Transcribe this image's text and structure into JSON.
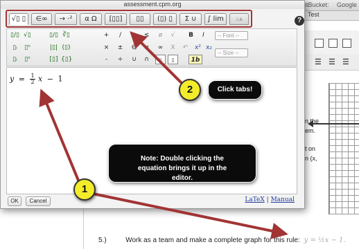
{
  "window": {
    "title": "assessment.cpm.org",
    "browser_tab_1": "itBucket:",
    "browser_tab_2": "Google",
    "doc_tab": "Test"
  },
  "editor": {
    "tabs": [
      {
        "label": "√▯ ▯",
        "icon": "roots-fractions-icon"
      },
      {
        "label": "∈∞",
        "icon": "set-infinity-icon"
      },
      {
        "label": "→ ⋅²",
        "icon": "arrows-exponent-icon"
      },
      {
        "label": "α Ω",
        "icon": "greek-letters-icon"
      },
      {
        "label": "[▯▯]",
        "icon": "matrix-icon"
      },
      {
        "label": "▯▯",
        "icon": "subscript-superscript-icon"
      },
      {
        "label": "(▯) ▯",
        "icon": "brackets-icon"
      },
      {
        "label": "Σ ∪",
        "icon": "sum-union-icon"
      },
      {
        "label": "∫ lim",
        "icon": "integral-limit-icon"
      },
      {
        "label": "▵▴",
        "icon": "extra-symbols-icon"
      }
    ],
    "help_label": "?",
    "toolbar": {
      "row1": [
        "▯/▯",
        "√▯",
        "▯/▯",
        "∛▯",
        "+",
        "/",
        "≥",
        "≤",
        "ø",
        "√",
        "B",
        "I"
      ],
      "row2": [
        "▯ᵢ",
        "▯ⁿ",
        "|▯|",
        "(▯)",
        "×",
        "±",
        "∈",
        "≠",
        "∞",
        "X",
        "↶",
        "x²",
        "x₂"
      ],
      "row3": [
        "▯ᵢ",
        "▯ⁿ",
        "[▯]",
        "{▯}",
        "-",
        "÷",
        "∪",
        "∩",
        "▯",
        "▯",
        "1b"
      ],
      "font_dropdown": "-- Font --",
      "size_dropdown": "-- Size --"
    },
    "equation": {
      "lhs": "y",
      "eq": "=",
      "num": "1",
      "den": "2",
      "var": "x",
      "minus": "−",
      "const": "1"
    },
    "buttons": {
      "ok": "OK",
      "cancel": "Cancel"
    },
    "links": {
      "latex": "LaTeX",
      "separator": "|",
      "manual": "Manual"
    }
  },
  "annotations": {
    "callout_1": "Note: Double clicking the equation brings it up in the editor.",
    "callout_2": "Click tabs!",
    "marker_1": "1",
    "marker_2": "2"
  },
  "background": {
    "snippet_1": "n the",
    "snippet_2": "em.",
    "snippet_3": "t on",
    "snippet_4": "n (x,",
    "problem_number": "5.)",
    "problem_text": "Work as a team and make a complete graph for this rule:",
    "problem_eq": "y = ½x − 1."
  }
}
